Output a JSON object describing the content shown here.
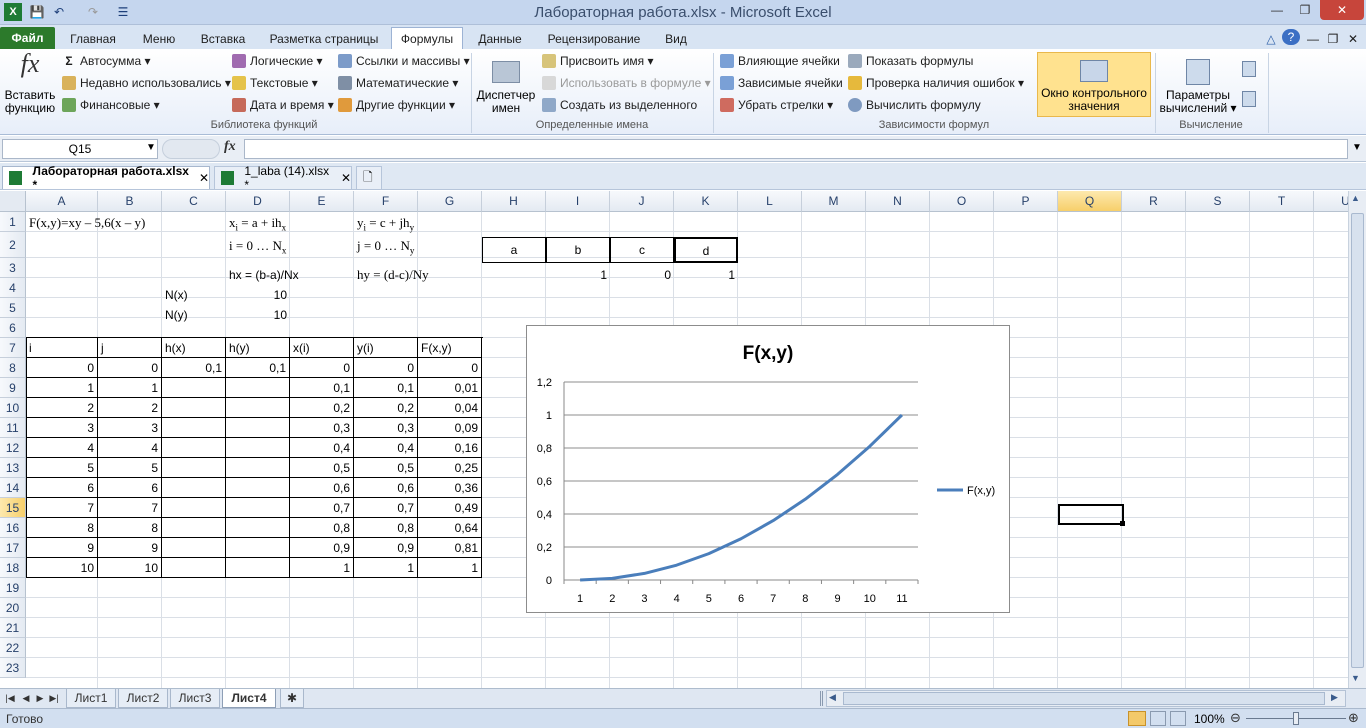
{
  "window": {
    "title": "Лабораторная работа.xlsx  -  Microsoft Excel"
  },
  "menu": {
    "file": "Файл",
    "tabs": [
      "Главная",
      "Меню",
      "Вставка",
      "Разметка страницы",
      "Формулы",
      "Данные",
      "Рецензирование",
      "Вид"
    ]
  },
  "ribbon": {
    "insert_function": [
      "Вставить",
      "функцию"
    ],
    "autosum": "Автосумма",
    "recent": "Недавно использовались",
    "financial": "Финансовые",
    "logical": "Логические",
    "text": "Текстовые",
    "datetime": "Дата и время",
    "lookup": "Ссылки и массивы",
    "math": "Математические",
    "other": "Другие функции",
    "group_library": "Библиотека функций",
    "name_manager": [
      "Диспетчер",
      "имен"
    ],
    "assign_name": "Присвоить имя",
    "use_in_formula": "Использовать в формуле",
    "create_from_selection": "Создать из выделенного",
    "group_names": "Определенные имена",
    "trace_precedents": "Влияющие ячейки",
    "trace_dependents": "Зависимые ячейки",
    "remove_arrows": "Убрать стрелки",
    "show_formulas": "Показать формулы",
    "error_check": "Проверка наличия ошибок",
    "evaluate": "Вычислить формулу",
    "watch_window": [
      "Окно контрольного",
      "значения"
    ],
    "group_audit": "Зависимости формул",
    "calc_options": [
      "Параметры",
      "вычислений"
    ],
    "group_calc": "Вычисление"
  },
  "formula_bar": {
    "name_box": "Q15",
    "fx": "fx",
    "content": ""
  },
  "doc_tabs": [
    {
      "label": "Лабораторная работа.xlsx *",
      "active": true
    },
    {
      "label": "1_laba (14).xlsx *",
      "active": false
    }
  ],
  "columns": [
    "A",
    "B",
    "C",
    "D",
    "E",
    "F",
    "G",
    "H",
    "I",
    "J",
    "K",
    "L",
    "M",
    "N",
    "O",
    "P",
    "Q",
    "R",
    "S",
    "T",
    "U"
  ],
  "rows": [
    "1",
    "2",
    "3",
    "4",
    "5",
    "6",
    "7",
    "8",
    "9",
    "10",
    "11",
    "12",
    "13",
    "14",
    "15",
    "16",
    "17",
    "18",
    "19",
    "20",
    "21",
    "22",
    "23"
  ],
  "cells": {
    "A1": "F(x,y)=xy – 5,6(x – y)",
    "D1": "xi = a + ihx",
    "F1": "yi = c + jhy",
    "D2": "i = 0 … Nx",
    "F2": "j = 0 … Ny",
    "H2": "a",
    "I2": "b",
    "J2": "c",
    "K2": "d",
    "D3": "hx = (b-a)/Nx",
    "F3": "hy = (d-c)/Ny",
    "I3": "1",
    "J3": "0",
    "K3": "1",
    "C4": "N(x)",
    "D4": "10",
    "C5": "N(y)",
    "D5": "10",
    "A7": "i",
    "B7": "j",
    "C7": "h(x)",
    "D7": "h(y)",
    "E7": "x(i)",
    "F7": "y(i)",
    "G7": "F(x,y)"
  },
  "table": {
    "i": [
      "0",
      "1",
      "2",
      "3",
      "4",
      "5",
      "6",
      "7",
      "8",
      "9",
      "10"
    ],
    "j": [
      "0",
      "1",
      "2",
      "3",
      "4",
      "5",
      "6",
      "7",
      "8",
      "9",
      "10"
    ],
    "hx": "0,1",
    "hy": "0,1",
    "x": [
      "0",
      "0,1",
      "0,2",
      "0,3",
      "0,4",
      "0,5",
      "0,6",
      "0,7",
      "0,8",
      "0,9",
      "1"
    ],
    "y": [
      "0",
      "0,1",
      "0,2",
      "0,3",
      "0,4",
      "0,5",
      "0,6",
      "0,7",
      "0,8",
      "0,9",
      "1"
    ],
    "f": [
      "0",
      "0,01",
      "0,04",
      "0,09",
      "0,16",
      "0,25",
      "0,36",
      "0,49",
      "0,64",
      "0,81",
      "1"
    ]
  },
  "chart_data": {
    "type": "line",
    "title": "F(x,y)",
    "categories": [
      "1",
      "2",
      "3",
      "4",
      "5",
      "6",
      "7",
      "8",
      "9",
      "10",
      "11"
    ],
    "series": [
      {
        "name": "F(x,y)",
        "values": [
          0,
          0.01,
          0.04,
          0.09,
          0.16,
          0.25,
          0.36,
          0.49,
          0.64,
          0.81,
          1
        ],
        "color": "#4a7ebb"
      }
    ],
    "ylim": [
      0,
      1.2
    ],
    "yticks": [
      "0",
      "0,2",
      "0,4",
      "0,6",
      "0,8",
      "1",
      "1,2"
    ],
    "grid": true,
    "legend": "right"
  },
  "sheets": [
    "Лист1",
    "Лист2",
    "Лист3",
    "Лист4"
  ],
  "active_sheet": "Лист4",
  "status": {
    "ready": "Готово",
    "zoom": "100%"
  }
}
